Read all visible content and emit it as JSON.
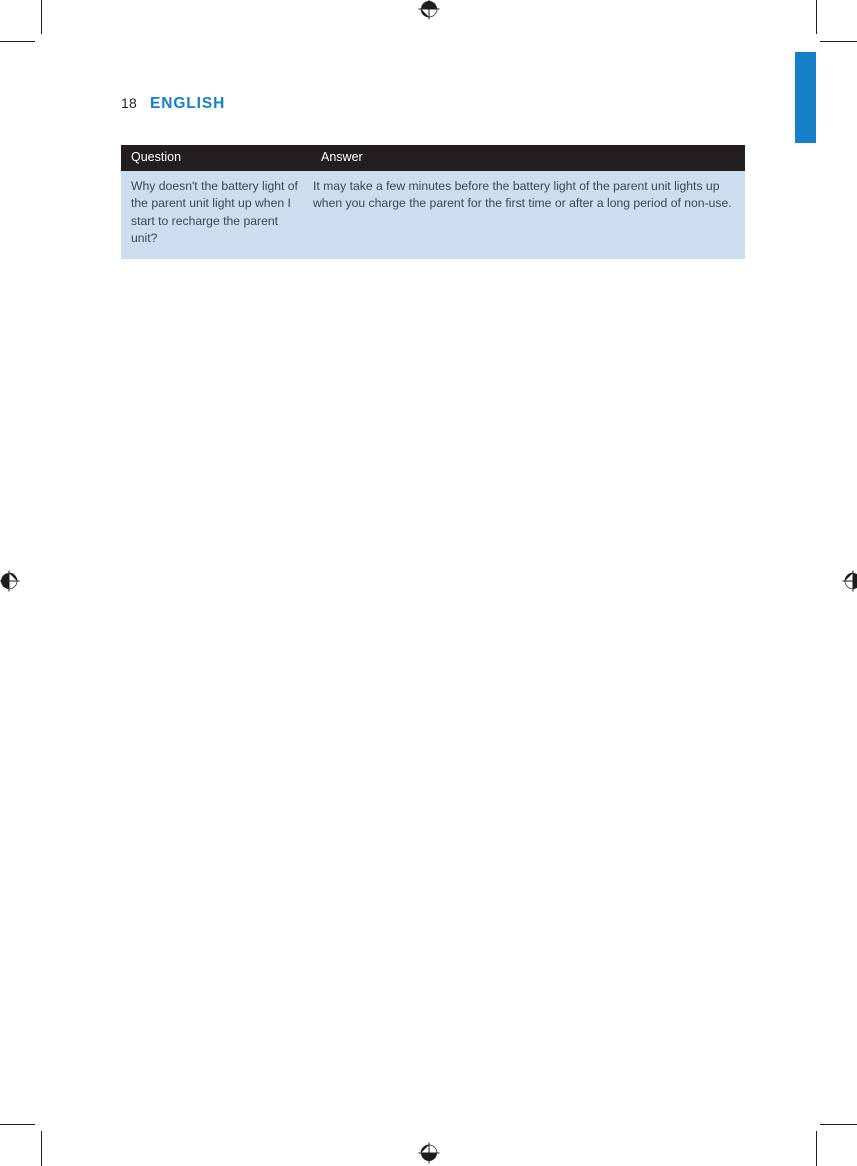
{
  "document": {
    "page_number": "18",
    "section_title": "ENGLISH",
    "accent_color": "#1580c8",
    "header_bar_color": "#231f20",
    "row_background_color": "#cbddef"
  },
  "marks": {
    "registration_top": "registration-target",
    "registration_bottom": "registration-target",
    "registration_left": "registration-target",
    "registration_right": "registration-target",
    "thumb_tab": "blue-thumb-tab"
  },
  "faq_table": {
    "columns": [
      {
        "key": "question",
        "label": "Question"
      },
      {
        "key": "answer",
        "label": "Answer"
      }
    ],
    "rows": [
      {
        "question": "Why doesn't the battery light of the parent unit light up when I start to recharge the parent unit?",
        "answer": "It may take a few minutes before the battery light of the parent unit lights up when you charge the parent for the first time or after a long period of non-use."
      }
    ]
  }
}
